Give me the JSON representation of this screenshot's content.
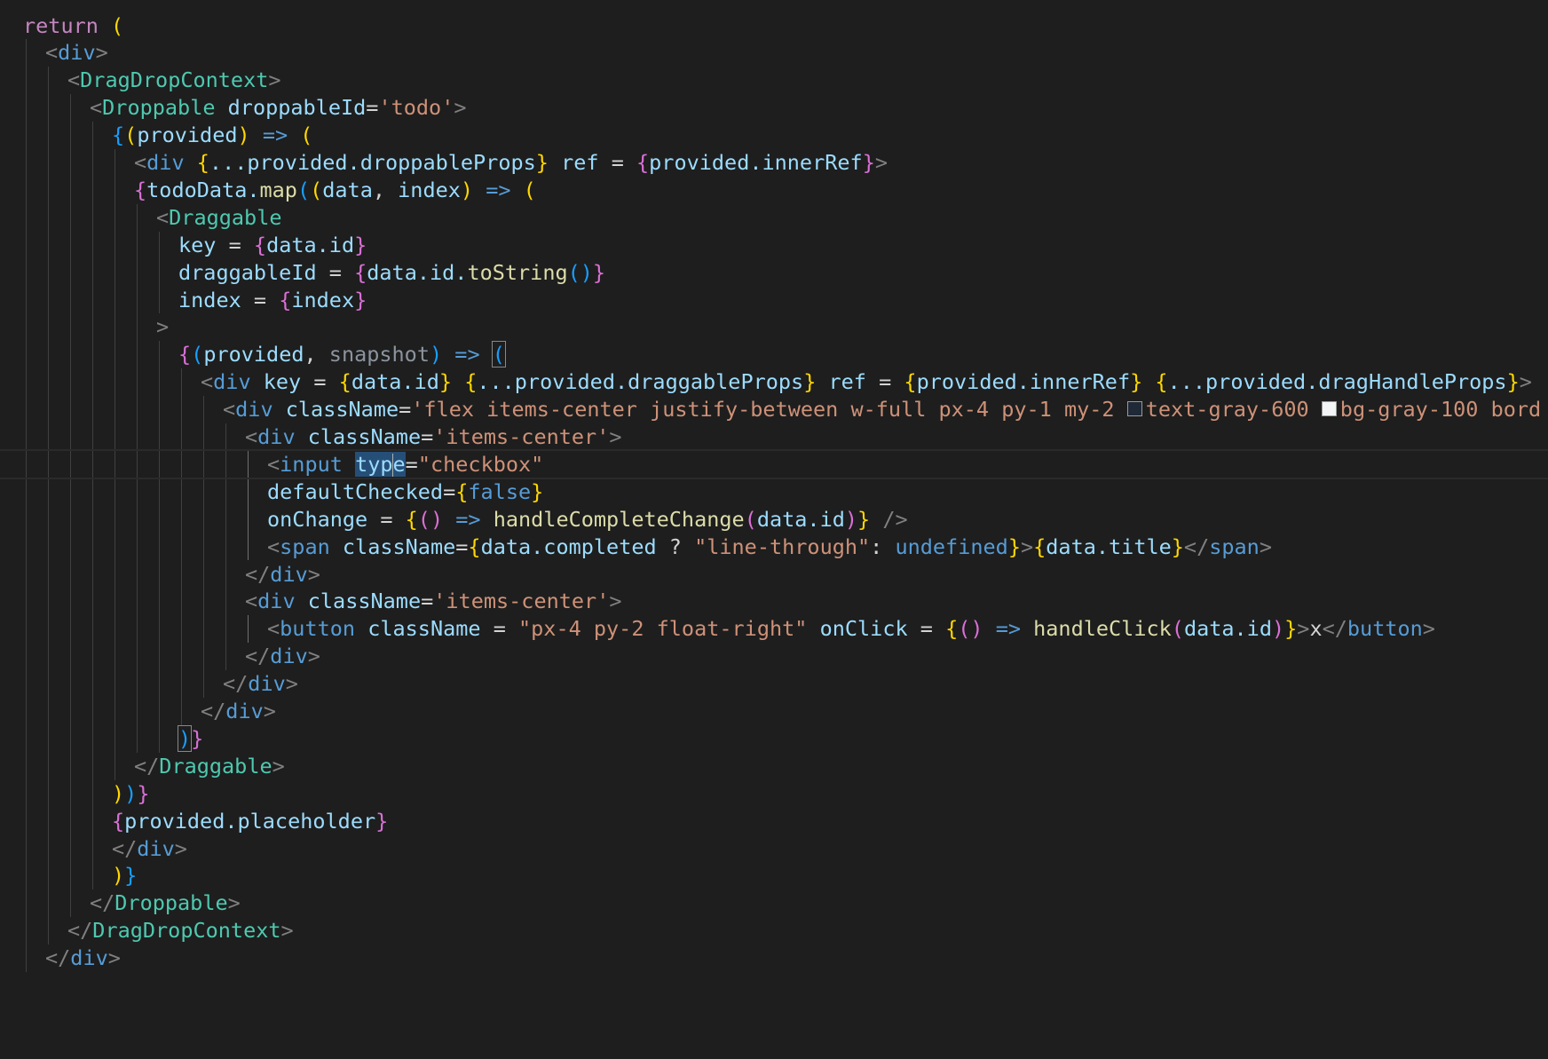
{
  "editor": {
    "lines": [
      {
        "indent": 0,
        "tokens": [
          {
            "t": "return",
            "c": "kw"
          },
          {
            "t": " "
          },
          {
            "t": "(",
            "c": "b1"
          }
        ]
      },
      {
        "indent": 1,
        "tokens": [
          {
            "t": "<",
            "c": "ang"
          },
          {
            "t": "div",
            "c": "htm"
          },
          {
            "t": ">",
            "c": "ang"
          }
        ]
      },
      {
        "indent": 2,
        "tokens": [
          {
            "t": "<",
            "c": "ang"
          },
          {
            "t": "DragDropContext",
            "c": "tag"
          },
          {
            "t": ">",
            "c": "ang"
          }
        ]
      },
      {
        "indent": 3,
        "tokens": [
          {
            "t": "<",
            "c": "ang"
          },
          {
            "t": "Droppable",
            "c": "tag"
          },
          {
            "t": " "
          },
          {
            "t": "droppableId",
            "c": "at"
          },
          {
            "t": "=",
            "c": "op"
          },
          {
            "t": "'todo'",
            "c": "st"
          },
          {
            "t": ">",
            "c": "ang"
          }
        ]
      },
      {
        "indent": 4,
        "tokens": [
          {
            "t": "{",
            "c": "b3"
          },
          {
            "t": "(",
            "c": "b1"
          },
          {
            "t": "provided",
            "c": "vr"
          },
          {
            "t": ")",
            "c": "b1"
          },
          {
            "t": " "
          },
          {
            "t": "=>",
            "c": "bl"
          },
          {
            "t": " "
          },
          {
            "t": "(",
            "c": "b1"
          }
        ]
      },
      {
        "indent": 5,
        "tokens": [
          {
            "t": "<",
            "c": "ang"
          },
          {
            "t": "div",
            "c": "htm"
          },
          {
            "t": " "
          },
          {
            "t": "{",
            "c": "b1"
          },
          {
            "t": "...provided.droppableProps",
            "c": "vr"
          },
          {
            "t": "}",
            "c": "b1"
          },
          {
            "t": " "
          },
          {
            "t": "ref",
            "c": "at"
          },
          {
            "t": " = ",
            "c": "op"
          },
          {
            "t": "{",
            "c": "b2"
          },
          {
            "t": "provided.innerRef",
            "c": "vr"
          },
          {
            "t": "}",
            "c": "b2"
          },
          {
            "t": ">",
            "c": "ang"
          }
        ]
      },
      {
        "indent": 5,
        "tokens": [
          {
            "t": "{",
            "c": "b2"
          },
          {
            "t": "todoData.",
            "c": "vr"
          },
          {
            "t": "map",
            "c": "fn"
          },
          {
            "t": "(",
            "c": "b3"
          },
          {
            "t": "(",
            "c": "b1"
          },
          {
            "t": "data",
            "c": "vr"
          },
          {
            "t": ", ",
            "c": "op"
          },
          {
            "t": "index",
            "c": "vr"
          },
          {
            "t": ")",
            "c": "b1"
          },
          {
            "t": " "
          },
          {
            "t": "=>",
            "c": "bl"
          },
          {
            "t": " "
          },
          {
            "t": "(",
            "c": "b1"
          }
        ]
      },
      {
        "indent": 6,
        "tokens": [
          {
            "t": "<",
            "c": "ang"
          },
          {
            "t": "Draggable",
            "c": "tag"
          }
        ]
      },
      {
        "indent": 7,
        "tokens": [
          {
            "t": "key",
            "c": "at"
          },
          {
            "t": " = ",
            "c": "op"
          },
          {
            "t": "{",
            "c": "b2"
          },
          {
            "t": "data.id",
            "c": "vr"
          },
          {
            "t": "}",
            "c": "b2"
          }
        ]
      },
      {
        "indent": 7,
        "tokens": [
          {
            "t": "draggableId",
            "c": "at"
          },
          {
            "t": " = ",
            "c": "op"
          },
          {
            "t": "{",
            "c": "b2"
          },
          {
            "t": "data.id.",
            "c": "vr"
          },
          {
            "t": "toString",
            "c": "fn"
          },
          {
            "t": "()",
            "c": "b3"
          },
          {
            "t": "}",
            "c": "b2"
          }
        ]
      },
      {
        "indent": 7,
        "tokens": [
          {
            "t": "index",
            "c": "at"
          },
          {
            "t": " = ",
            "c": "op"
          },
          {
            "t": "{",
            "c": "b2"
          },
          {
            "t": "index",
            "c": "vr"
          },
          {
            "t": "}",
            "c": "b2"
          }
        ]
      },
      {
        "indent": 6,
        "tokens": [
          {
            "t": ">",
            "c": "ang"
          }
        ]
      },
      {
        "indent": 7,
        "tokens": [
          {
            "t": "{",
            "c": "b2"
          },
          {
            "t": "(",
            "c": "b3"
          },
          {
            "t": "provided",
            "c": "vr"
          },
          {
            "t": ", ",
            "c": "op"
          },
          {
            "t": "snapshot",
            "c": "dim"
          },
          {
            "t": ")",
            "c": "b3"
          },
          {
            "t": " "
          },
          {
            "t": "=>",
            "c": "bl"
          },
          {
            "t": " "
          },
          {
            "t": "(",
            "c": "b3",
            "bm": true
          }
        ]
      },
      {
        "indent": 8,
        "tokens": [
          {
            "t": "<",
            "c": "ang"
          },
          {
            "t": "div",
            "c": "htm"
          },
          {
            "t": " "
          },
          {
            "t": "key",
            "c": "at"
          },
          {
            "t": " = ",
            "c": "op"
          },
          {
            "t": "{",
            "c": "b1"
          },
          {
            "t": "data.id",
            "c": "vr"
          },
          {
            "t": "}",
            "c": "b1"
          },
          {
            "t": " "
          },
          {
            "t": "{",
            "c": "b1"
          },
          {
            "t": "...provided.draggableProps",
            "c": "vr"
          },
          {
            "t": "}",
            "c": "b1"
          },
          {
            "t": " "
          },
          {
            "t": "ref",
            "c": "at"
          },
          {
            "t": " = ",
            "c": "op"
          },
          {
            "t": "{",
            "c": "b1"
          },
          {
            "t": "provided.innerRef",
            "c": "vr"
          },
          {
            "t": "}",
            "c": "b1"
          },
          {
            "t": " "
          },
          {
            "t": "{",
            "c": "b1"
          },
          {
            "t": "...provided.dragHandleProps",
            "c": "vr"
          },
          {
            "t": "}",
            "c": "b1"
          },
          {
            "t": ">",
            "c": "ang"
          }
        ]
      },
      {
        "indent": 9,
        "tokens": [
          {
            "t": "<",
            "c": "ang"
          },
          {
            "t": "div",
            "c": "htm"
          },
          {
            "t": " "
          },
          {
            "t": "className",
            "c": "at"
          },
          {
            "t": "=",
            "c": "op"
          },
          {
            "t": "'flex items-center justify-between w-full px-4 py-1 my-2 ",
            "c": "st"
          },
          {
            "t": "",
            "swatch": "#1f2937"
          },
          {
            "t": "text-gray-600 ",
            "c": "st"
          },
          {
            "t": "",
            "swatch": "#f3f4f6"
          },
          {
            "t": "bg-gray-100 bord",
            "c": "st"
          }
        ]
      },
      {
        "indent": 10,
        "tokens": [
          {
            "t": "<",
            "c": "ang"
          },
          {
            "t": "div",
            "c": "htm"
          },
          {
            "t": " "
          },
          {
            "t": "className",
            "c": "at"
          },
          {
            "t": "=",
            "c": "op"
          },
          {
            "t": "'items-center'",
            "c": "st"
          },
          {
            "t": ">",
            "c": "ang"
          }
        ]
      },
      {
        "indent": 11,
        "current": true,
        "tokens": [
          {
            "t": "<",
            "c": "ang"
          },
          {
            "t": "input",
            "c": "htm"
          },
          {
            "t": " "
          },
          {
            "t": "typ",
            "c": "at",
            "sel": true
          },
          {
            "t": "",
            "cursor": true
          },
          {
            "t": "e",
            "c": "at",
            "sel": true
          },
          {
            "t": "=",
            "c": "op"
          },
          {
            "t": "\"checkbox\"",
            "c": "st"
          }
        ]
      },
      {
        "indent": 11,
        "tokens": [
          {
            "t": "defaultChecked",
            "c": "at"
          },
          {
            "t": "=",
            "c": "op"
          },
          {
            "t": "{",
            "c": "b1"
          },
          {
            "t": "false",
            "c": "bl"
          },
          {
            "t": "}",
            "c": "b1"
          }
        ]
      },
      {
        "indent": 11,
        "tokens": [
          {
            "t": "onChange",
            "c": "at"
          },
          {
            "t": " = ",
            "c": "op"
          },
          {
            "t": "{",
            "c": "b1"
          },
          {
            "t": "()",
            "c": "b2"
          },
          {
            "t": " "
          },
          {
            "t": "=>",
            "c": "bl"
          },
          {
            "t": " "
          },
          {
            "t": "handleCompleteChange",
            "c": "fn"
          },
          {
            "t": "(",
            "c": "b2"
          },
          {
            "t": "data.id",
            "c": "vr"
          },
          {
            "t": ")",
            "c": "b2"
          },
          {
            "t": "}",
            "c": "b1"
          },
          {
            "t": " "
          },
          {
            "t": "/>",
            "c": "ang"
          }
        ]
      },
      {
        "indent": 11,
        "tokens": [
          {
            "t": "<",
            "c": "ang"
          },
          {
            "t": "span",
            "c": "htm"
          },
          {
            "t": " "
          },
          {
            "t": "className",
            "c": "at"
          },
          {
            "t": "=",
            "c": "op"
          },
          {
            "t": "{",
            "c": "b1"
          },
          {
            "t": "data.completed",
            "c": "vr"
          },
          {
            "t": " ? ",
            "c": "op"
          },
          {
            "t": "\"line-through\"",
            "c": "st"
          },
          {
            "t": ": ",
            "c": "op"
          },
          {
            "t": "undefined",
            "c": "bl"
          },
          {
            "t": "}",
            "c": "b1"
          },
          {
            "t": ">",
            "c": "ang"
          },
          {
            "t": "{",
            "c": "b1"
          },
          {
            "t": "data.title",
            "c": "vr"
          },
          {
            "t": "}",
            "c": "b1"
          },
          {
            "t": "</",
            "c": "ang"
          },
          {
            "t": "span",
            "c": "htm"
          },
          {
            "t": ">",
            "c": "ang"
          }
        ]
      },
      {
        "indent": 10,
        "tokens": [
          {
            "t": "</",
            "c": "ang"
          },
          {
            "t": "div",
            "c": "htm"
          },
          {
            "t": ">",
            "c": "ang"
          }
        ]
      },
      {
        "indent": 10,
        "tokens": [
          {
            "t": "<",
            "c": "ang"
          },
          {
            "t": "div",
            "c": "htm"
          },
          {
            "t": " "
          },
          {
            "t": "className",
            "c": "at"
          },
          {
            "t": "=",
            "c": "op"
          },
          {
            "t": "'items-center'",
            "c": "st"
          },
          {
            "t": ">",
            "c": "ang"
          }
        ]
      },
      {
        "indent": 11,
        "tokens": [
          {
            "t": "<",
            "c": "ang"
          },
          {
            "t": "button",
            "c": "htm"
          },
          {
            "t": " "
          },
          {
            "t": "className",
            "c": "at"
          },
          {
            "t": " = ",
            "c": "op"
          },
          {
            "t": "\"px-4 py-2 float-right\"",
            "c": "st"
          },
          {
            "t": " "
          },
          {
            "t": "onClick",
            "c": "at"
          },
          {
            "t": " = ",
            "c": "op"
          },
          {
            "t": "{",
            "c": "b1"
          },
          {
            "t": "()",
            "c": "b2"
          },
          {
            "t": " "
          },
          {
            "t": "=>",
            "c": "bl"
          },
          {
            "t": " "
          },
          {
            "t": "handleClick",
            "c": "fn"
          },
          {
            "t": "(",
            "c": "b2"
          },
          {
            "t": "data.id",
            "c": "vr"
          },
          {
            "t": ")",
            "c": "b2"
          },
          {
            "t": "}",
            "c": "b1"
          },
          {
            "t": ">",
            "c": "ang"
          },
          {
            "t": "x",
            "c": "txt"
          },
          {
            "t": "</",
            "c": "ang"
          },
          {
            "t": "button",
            "c": "htm"
          },
          {
            "t": ">",
            "c": "ang"
          }
        ]
      },
      {
        "indent": 10,
        "tokens": [
          {
            "t": "</",
            "c": "ang"
          },
          {
            "t": "div",
            "c": "htm"
          },
          {
            "t": ">",
            "c": "ang"
          }
        ]
      },
      {
        "indent": 9,
        "tokens": [
          {
            "t": "</",
            "c": "ang"
          },
          {
            "t": "div",
            "c": "htm"
          },
          {
            "t": ">",
            "c": "ang"
          }
        ]
      },
      {
        "indent": 8,
        "tokens": [
          {
            "t": "</",
            "c": "ang"
          },
          {
            "t": "div",
            "c": "htm"
          },
          {
            "t": ">",
            "c": "ang"
          }
        ]
      },
      {
        "indent": 7,
        "tokens": [
          {
            "t": ")",
            "c": "b3",
            "bm": true
          },
          {
            "t": "}",
            "c": "b2"
          }
        ]
      },
      {
        "indent": 5,
        "tokens": [
          {
            "t": "</",
            "c": "ang"
          },
          {
            "t": "Draggable",
            "c": "tag"
          },
          {
            "t": ">",
            "c": "ang"
          }
        ]
      },
      {
        "indent": 4,
        "tokens": [
          {
            "t": ")",
            "c": "b1"
          },
          {
            "t": ")",
            "c": "b3"
          },
          {
            "t": "}",
            "c": "b2"
          }
        ]
      },
      {
        "indent": 4,
        "tokens": [
          {
            "t": "{",
            "c": "b2"
          },
          {
            "t": "provided.placeholder",
            "c": "vr"
          },
          {
            "t": "}",
            "c": "b2"
          }
        ]
      },
      {
        "indent": 4,
        "tokens": [
          {
            "t": "</",
            "c": "ang"
          },
          {
            "t": "div",
            "c": "htm"
          },
          {
            "t": ">",
            "c": "ang"
          }
        ]
      },
      {
        "indent": 4,
        "tokens": [
          {
            "t": ")",
            "c": "b1"
          },
          {
            "t": "}",
            "c": "b3"
          }
        ]
      },
      {
        "indent": 3,
        "tokens": [
          {
            "t": "</",
            "c": "ang"
          },
          {
            "t": "Droppable",
            "c": "tag"
          },
          {
            "t": ">",
            "c": "ang"
          }
        ]
      },
      {
        "indent": 2,
        "tokens": [
          {
            "t": "</",
            "c": "ang"
          },
          {
            "t": "DragDropContext",
            "c": "tag"
          },
          {
            "t": ">",
            "c": "ang"
          }
        ]
      },
      {
        "indent": 1,
        "tokens": [
          {
            "t": "</",
            "c": "ang"
          },
          {
            "t": "div",
            "c": "htm"
          },
          {
            "t": ">",
            "c": "ang"
          }
        ]
      }
    ]
  }
}
